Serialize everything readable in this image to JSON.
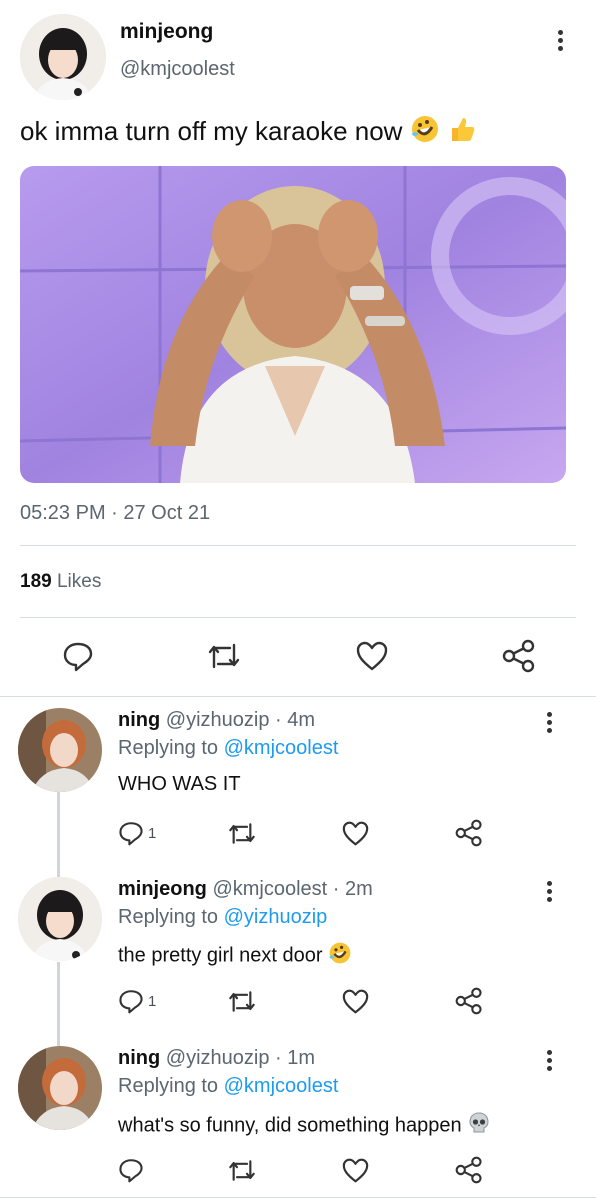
{
  "main_tweet": {
    "author_name": "minjeong",
    "author_handle": "@kmjcoolest",
    "text": "ok imma turn off my karaoke now",
    "timestamp": "05:23 PM · 27 Oct 21",
    "likes_count": "189",
    "likes_label": "Likes",
    "emojis": [
      "rolling-on-floor-laughing",
      "thumbs-up"
    ]
  },
  "replies": [
    {
      "author_name": "ning",
      "author_handle": "@yizhuozip",
      "time": "· 4m",
      "replying_label": "Replying to",
      "replying_to": "@kmjcoolest",
      "text": "WHO WAS IT",
      "reply_count": "1"
    },
    {
      "author_name": "minjeong",
      "author_handle": "@kmjcoolest",
      "time": "· 2m",
      "replying_label": "Replying to",
      "replying_to": "@yizhuozip",
      "text": "the pretty girl next door",
      "reply_count": "1"
    },
    {
      "author_name": "ning",
      "author_handle": "@yizhuozip",
      "time": "· 1m",
      "replying_label": "Replying to",
      "replying_to": "@kmjcoolest",
      "text": "what's so funny, did something happen",
      "reply_count": ""
    }
  ],
  "colors": {
    "link": "#1d9bf0",
    "secondary_text": "#5b6670",
    "divider": "#d8dde1",
    "media_bg": "#a98ee0"
  }
}
